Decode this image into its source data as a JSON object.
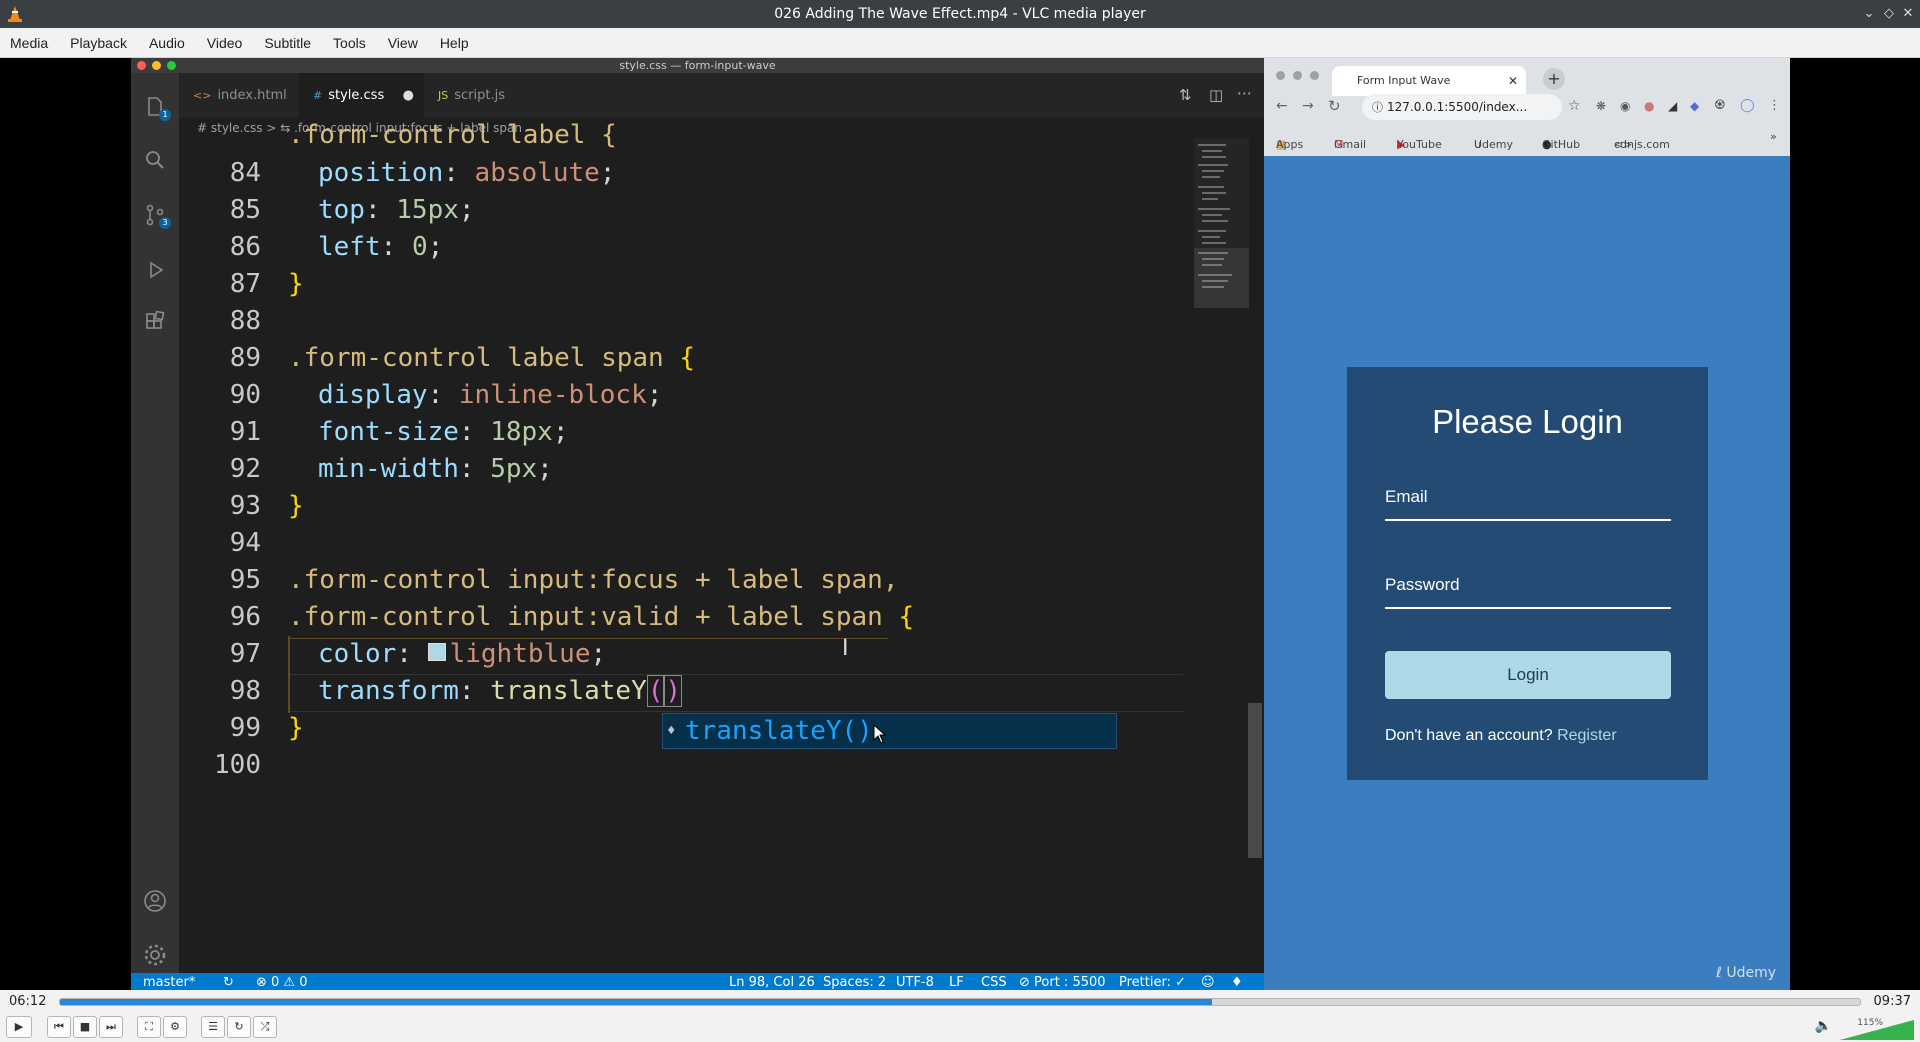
{
  "window": {
    "title": "026 Adding The Wave Effect.mp4 - VLC media player"
  },
  "menu": [
    "Media",
    "Playback",
    "Audio",
    "Video",
    "Subtitle",
    "Tools",
    "View",
    "Help"
  ],
  "vscode": {
    "title": "style.css — form-input-wave",
    "tabs": [
      {
        "icon": "<>",
        "label": "index.html"
      },
      {
        "icon": "#",
        "label": "style.css"
      },
      {
        "icon": "JS",
        "label": "script.js"
      }
    ],
    "explorer_badge": "1",
    "scm_badge": "3",
    "breadcrumb": "# style.css > ⇆ .form-control input:focus + label span",
    "line_numbers": [
      "84",
      "85",
      "86",
      "87",
      "88",
      "89",
      "90",
      "91",
      "92",
      "93",
      "94",
      "95",
      "96",
      "97",
      "98",
      "99",
      "100"
    ],
    "code": {
      "l83": ".form-control label {",
      "l84_prop": "position",
      "l84_val": "absolute",
      "l85_prop": "top",
      "l85_val": "15px",
      "l86_prop": "left",
      "l86_val": "0",
      "l89_sel": ".form-control label span",
      "l90_prop": "display",
      "l90_val": "inline-block",
      "l91_prop": "font-size",
      "l91_val": "18px",
      "l92_prop": "min-width",
      "l92_val": "5px",
      "l95_sel": ".form-control input:focus + label span,",
      "l96_sel": ".form-control input:valid + label span",
      "l97_prop": "color",
      "l97_val": "lightblue",
      "l98_prop": "transform",
      "l98_val": "translateY"
    },
    "suggestion": "translateY()",
    "status": {
      "branch": "master*",
      "problems": "⊗ 0 ⚠ 0",
      "position": "Ln 98, Col 26",
      "spaces": "Spaces: 2",
      "encoding": "UTF-8",
      "eol": "LF",
      "language": "CSS",
      "port": "⊘ Port : 5500",
      "prettier": "Prettier: ✓"
    }
  },
  "browser": {
    "tab_title": "Form Input Wave",
    "url": "127.0.0.1:5500/index...",
    "bookmarks": [
      "Apps",
      "Gmail",
      "YouTube",
      "Udemy",
      "GitHub",
      "cdnjs.com"
    ],
    "form": {
      "heading": "Please Login",
      "email_label": "Email",
      "password_label": "Password",
      "login_label": "Login",
      "register_prompt": "Don't have an account?",
      "register_link": "Register"
    },
    "watermark": "Udemy"
  },
  "player": {
    "time_current": "06:12",
    "time_total": "09:37",
    "progress": 0.64,
    "volume_label": "115%"
  },
  "colors": {
    "vlc_accent": "#2a84d8",
    "vscode_status": "#007acc",
    "browser_bg": "#3b7ec0"
  }
}
